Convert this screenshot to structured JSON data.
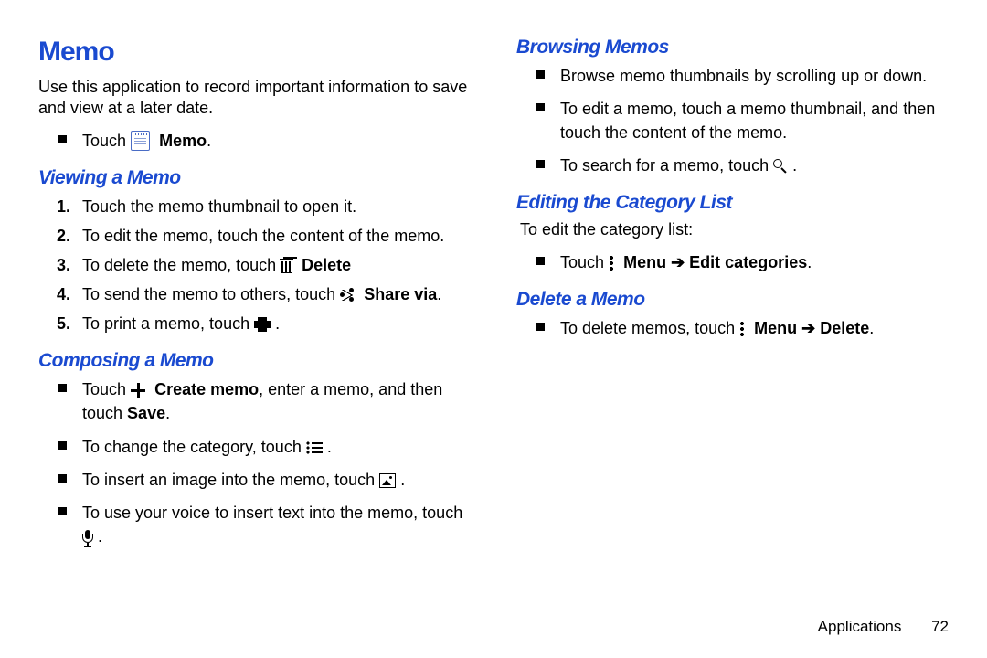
{
  "title": "Memo",
  "intro": "Use this application to record important information to save and view at a later date.",
  "touch_memo": {
    "prefix": "Touch ",
    "label": "Memo",
    "suffix": "."
  },
  "viewing": {
    "heading": "Viewing a Memo",
    "items": [
      {
        "text": "Touch the memo thumbnail to open it."
      },
      {
        "text": "To edit the memo, touch the content of the memo."
      },
      {
        "prefix": "To delete the memo, touch ",
        "label": "Delete"
      },
      {
        "prefix": "To send the memo to others, touch ",
        "label": "Share via",
        "suffix": "."
      },
      {
        "prefix": "To print a memo, touch ",
        "suffix": "."
      }
    ]
  },
  "composing": {
    "heading": "Composing a Memo",
    "items": [
      {
        "prefix": "Touch ",
        "label": "Create memo",
        "mid": ", enter a memo, and then touch ",
        "label2": "Save",
        "suffix": "."
      },
      {
        "prefix": "To change the category, touch ",
        "suffix": "."
      },
      {
        "prefix": "To insert an image into the memo, touch ",
        "suffix": "."
      },
      {
        "prefix": "To use your voice to insert text into the memo, touch ",
        "suffix": "."
      }
    ]
  },
  "browsing": {
    "heading": "Browsing Memos",
    "items": [
      {
        "text": "Browse memo thumbnails by scrolling up or down."
      },
      {
        "text": "To edit a memo, touch a memo thumbnail, and then touch the content of the memo."
      },
      {
        "prefix": "To search for a memo, touch ",
        "suffix": "."
      }
    ]
  },
  "editing_cat": {
    "heading": "Editing the Category List",
    "intro": "To edit the category list:",
    "item": {
      "prefix": "Touch ",
      "label1": "Menu",
      "arrow": " ➔ ",
      "label2": "Edit categories",
      "suffix": "."
    }
  },
  "delete_memo": {
    "heading": "Delete a Memo",
    "item": {
      "prefix": "To delete memos, touch ",
      "label1": "Menu",
      "arrow": " ➔ ",
      "label2": "Delete",
      "suffix": "."
    }
  },
  "footer": {
    "section": "Applications",
    "page": "72"
  }
}
